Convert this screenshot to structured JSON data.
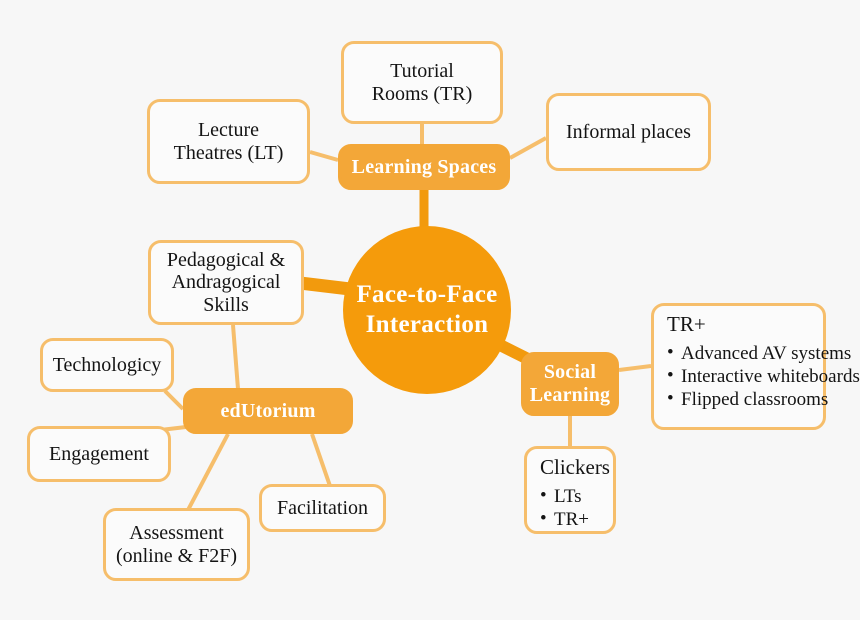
{
  "diagram": {
    "type": "mind-map",
    "background_color": "#f7f7f7",
    "palette": {
      "hub_fill": "#f59b0b",
      "branch_fill": "#f3a738",
      "leaf_border": "#f6be6b",
      "leaf_fill": "#fbfbfb",
      "connector": "#f6be6b",
      "trunk": "#f29a0d",
      "text_dark": "#141414",
      "text_light": "#ffffff"
    }
  },
  "hub": {
    "line1": "Face-to-Face",
    "line2": "Interaction"
  },
  "branches": {
    "learning_spaces": {
      "label": "Learning Spaces",
      "children": {
        "tutorial_rooms": {
          "line1": "Tutorial",
          "line2": "Rooms (TR)"
        },
        "lecture_theatres": {
          "line1": "Lecture",
          "line2": "Theatres (LT)"
        },
        "informal_places": {
          "line1": "Informal places"
        }
      }
    },
    "edutorium": {
      "label": "edUtorium",
      "parent_skill": {
        "line1": "Pedagogical &",
        "line2": "Andragogical",
        "line3": "Skills"
      },
      "children": {
        "technologicy": {
          "line1": "Technologicy"
        },
        "engagement": {
          "line1": "Engagement"
        },
        "assessment": {
          "line1": "Assessment",
          "line2": "(online & F2F)"
        },
        "facilitation": {
          "line1": "Facilitation"
        }
      }
    },
    "social_learning": {
      "label_line1": "Social",
      "label_line2": "Learning",
      "children": {
        "tr_plus": {
          "title": "TR+",
          "bullets": [
            "Advanced AV systems",
            "Interactive whiteboards",
            "Flipped classrooms"
          ]
        },
        "clickers": {
          "title": "Clickers",
          "bullets": [
            "LTs",
            "TR+"
          ]
        }
      }
    }
  }
}
